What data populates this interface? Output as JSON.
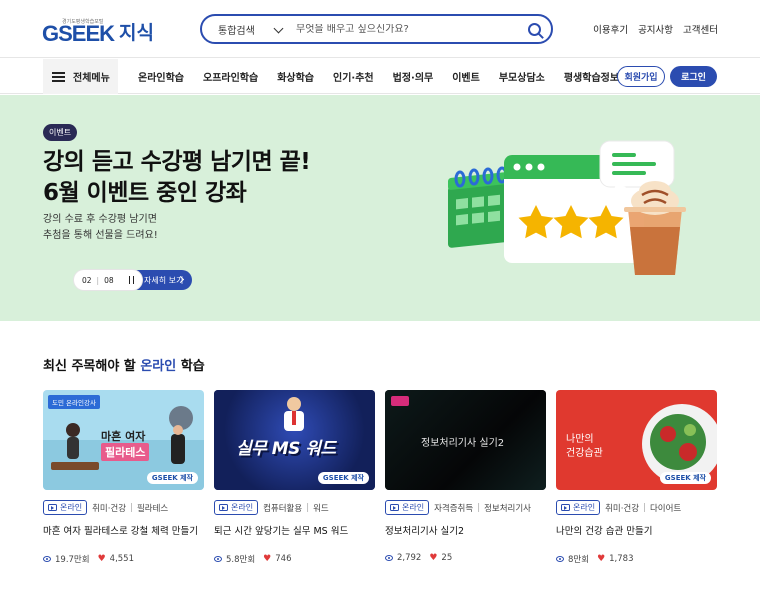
{
  "header": {
    "logo_sub": "경기도평생학습포털",
    "logo_main": "GSEEK",
    "logo_suffix": "지식",
    "search_scope": "통합검색",
    "search_placeholder": "무엇을 배우고 싶으신가요?",
    "links": [
      "이용후기",
      "공지사항",
      "고객센터"
    ]
  },
  "nav": {
    "all_menu": "전체메뉴",
    "items": [
      "온라인학습",
      "오프라인학습",
      "화상학습",
      "인기·추천",
      "법정·의무",
      "이벤트",
      "부모상담소",
      "평생학습정보"
    ],
    "signup": "회원가입",
    "login": "로그인"
  },
  "hero": {
    "badge": "이벤트",
    "title_line1": "강의 듣고 수강평 남기면 끝!",
    "title_line2": "6월 이벤트 중인 강좌",
    "desc_line1": "강의 수료 후 수강평 남기면",
    "desc_line2": "추첨을 통해 선물을 드려요!",
    "page_current": "02",
    "page_total": "08",
    "detail_button": "자세히 보기"
  },
  "section": {
    "title_pre": "최신 주목해야 할 ",
    "title_highlight": "온라인",
    "title_post": " 학습"
  },
  "cards": [
    {
      "thumb_badge": "도민 온라인강사",
      "thumb_line1": "마흔 여자",
      "thumb_line2": "필라테스",
      "type": "온라인",
      "cat1": "취미·건강",
      "cat2": "필라테스",
      "title": "마흔 여자 필라테스로 강철 체력 만들기",
      "views": "19.7만회",
      "likes": "4,551"
    },
    {
      "thumb_line1": "실무 MS 워드",
      "type": "온라인",
      "cat1": "컴퓨터활용",
      "cat2": "워드",
      "title": "퇴근 시간 앞당기는 실무 MS 워드",
      "views": "5.8만회",
      "likes": "746"
    },
    {
      "thumb_line1": "정보처리기사 실기2",
      "type": "온라인",
      "cat1": "자격증취득",
      "cat2": "정보처리기사",
      "title": "정보처리기사 실기2",
      "views": "2,792",
      "likes": "25"
    },
    {
      "thumb_line1": "나만의",
      "thumb_line2": "건강습관",
      "type": "온라인",
      "cat1": "취미·건강",
      "cat2": "다이어트",
      "title": "나만의 건강 습관 만들기",
      "views": "8만회",
      "likes": "1,783"
    }
  ],
  "thumb_brand": "GSEEK 제작",
  "colors": {
    "brand_blue": "#2b4cb0",
    "hero_bg": "#d8f0da",
    "heart": "#e03a3a"
  }
}
